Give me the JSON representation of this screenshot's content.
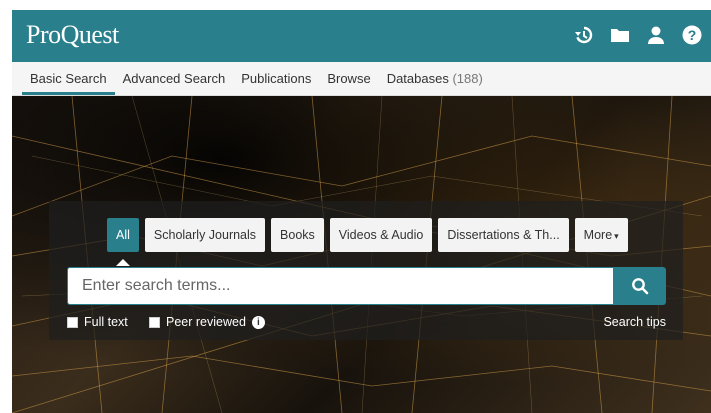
{
  "brand": {
    "logo_text": "ProQuest",
    "accent": "#2a7f8c"
  },
  "header": {
    "icons": [
      "history-icon",
      "folder-icon",
      "user-icon",
      "help-icon"
    ]
  },
  "nav": {
    "tabs": [
      {
        "label": "Basic Search"
      },
      {
        "label": "Advanced Search"
      },
      {
        "label": "Publications"
      },
      {
        "label": "Browse"
      },
      {
        "label": "Databases"
      }
    ],
    "databases_count": "(188)",
    "active_tab": "Basic Search"
  },
  "search": {
    "source_types": [
      "All",
      "Scholarly Journals",
      "Books",
      "Videos & Audio",
      "Dissertations & Th...",
      "More"
    ],
    "active_type": "All",
    "placeholder": "Enter search terms...",
    "value": "",
    "full_text_label": "Full text",
    "peer_reviewed_label": "Peer reviewed",
    "search_tips_label": "Search tips"
  }
}
